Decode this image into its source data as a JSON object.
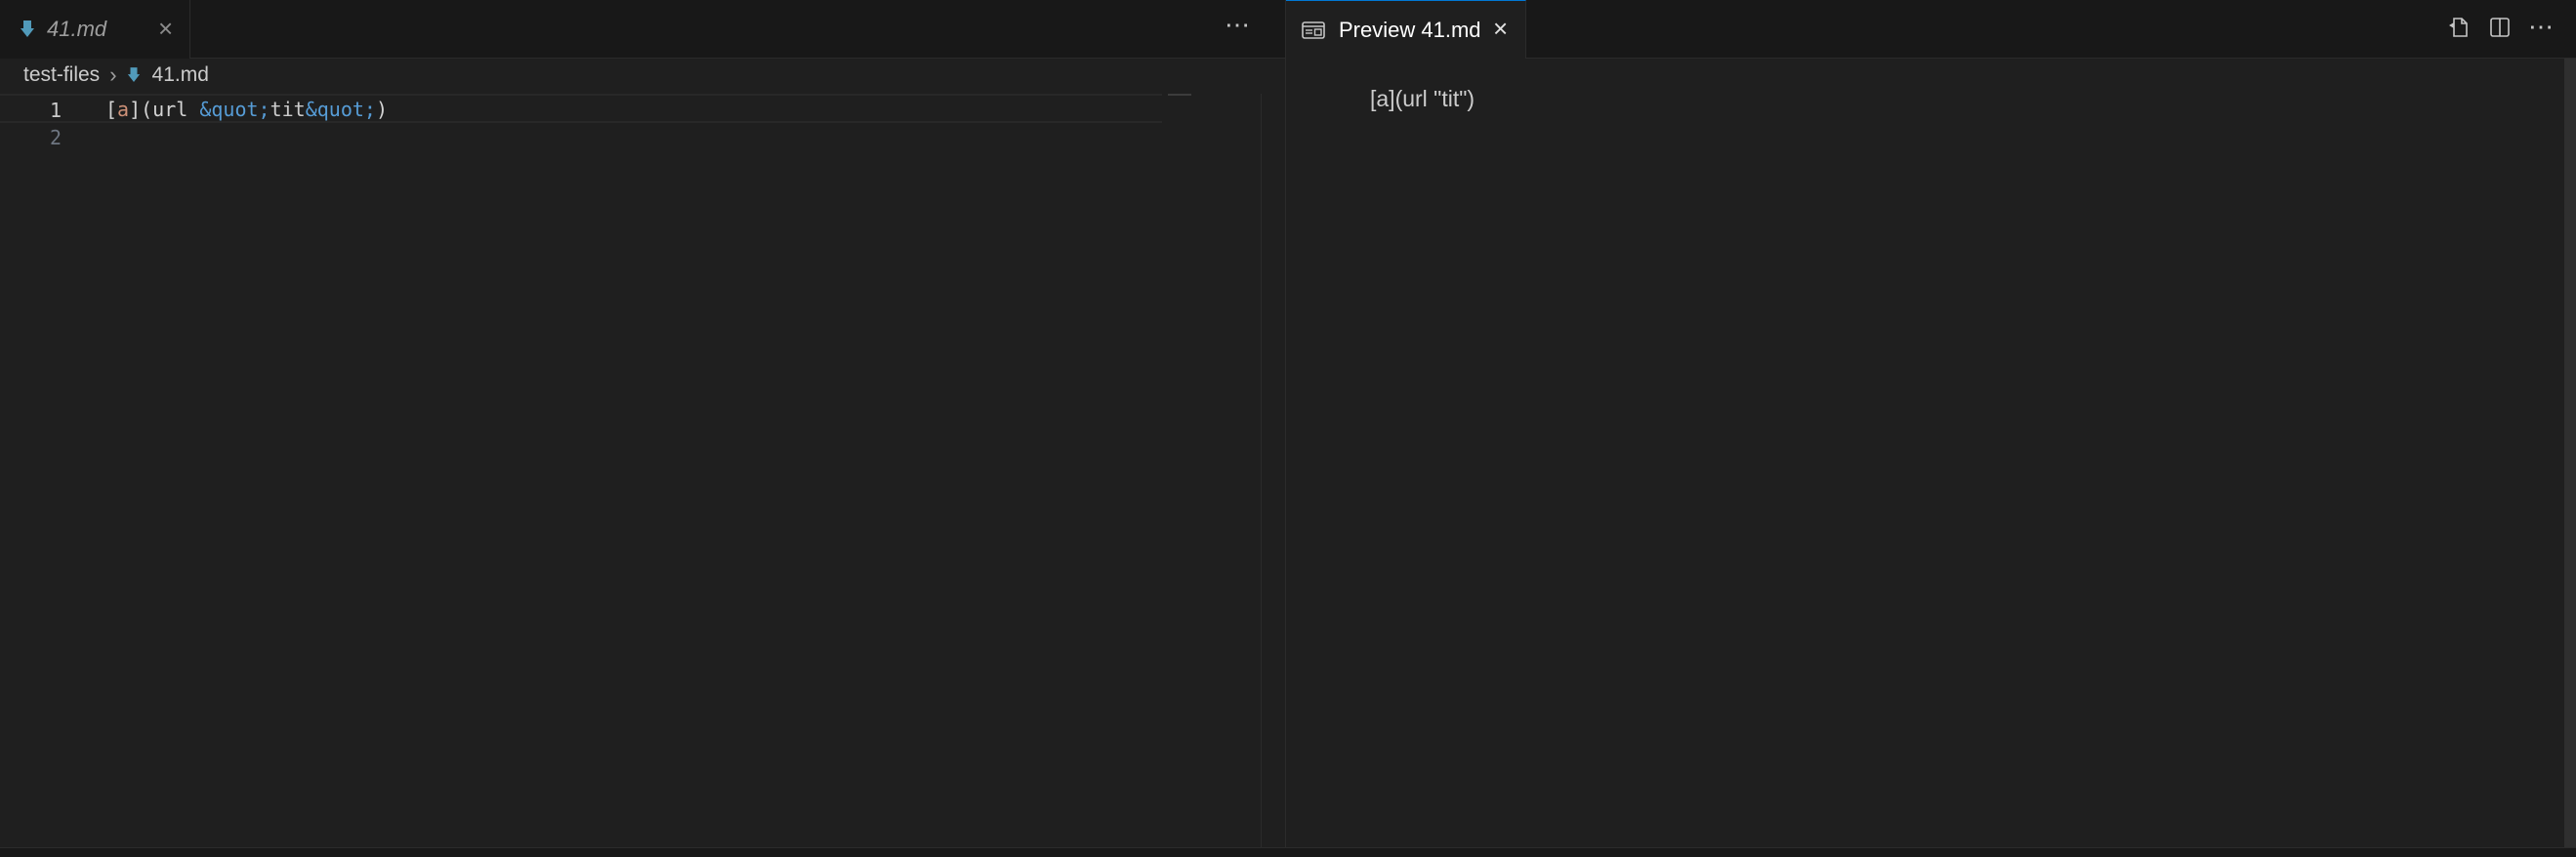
{
  "left_editor": {
    "tab": {
      "label": "41.md",
      "icon": "markdown-file-icon"
    },
    "breadcrumb": {
      "folder": "test-files",
      "file": "41.md"
    },
    "lines": [
      {
        "number": "1",
        "tokens": [
          {
            "text": "[",
            "kind": "bracket"
          },
          {
            "text": "a",
            "kind": "link-text"
          },
          {
            "text": "](url ",
            "kind": "bracket"
          },
          {
            "text": "&quot;",
            "kind": "entity"
          },
          {
            "text": "tit",
            "kind": "plain"
          },
          {
            "text": "&quot;",
            "kind": "entity"
          },
          {
            "text": ")",
            "kind": "bracket"
          }
        ]
      },
      {
        "number": "2",
        "tokens": []
      }
    ],
    "more_actions_icon": "ellipsis-icon"
  },
  "right_editor": {
    "tab": {
      "label": "Preview 41.md",
      "icon": "preview-icon"
    },
    "content": "[a](url \"tit\")",
    "actions": [
      "open-source-icon",
      "split-editor-icon",
      "ellipsis-icon"
    ]
  },
  "colors": {
    "background": "#1f1f1f",
    "tabbar": "#181818",
    "link_text": "#ce9178",
    "entity": "#569cd6",
    "accent": "#0078d4"
  }
}
